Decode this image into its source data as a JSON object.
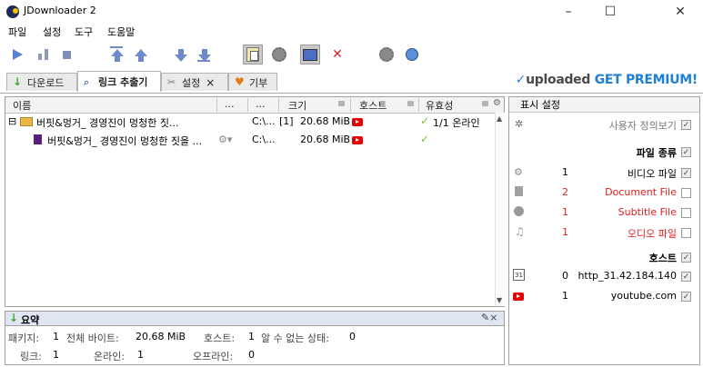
{
  "window": {
    "title": "JDownloader 2",
    "minimize_icon": "minimize-icon",
    "maximize_icon": "maximize-icon",
    "close_icon": "close-icon"
  },
  "menu": [
    "파일",
    "설정",
    "도구",
    "도움말"
  ],
  "tabs": [
    {
      "label": "다운로드",
      "icon": "download-arrow-icon"
    },
    {
      "label": "링크 추출기",
      "icon": "linkgrabber-icon"
    },
    {
      "label": "설정",
      "icon": "settings-icon",
      "close": "×"
    },
    {
      "label": "기부",
      "icon": "heart-icon"
    }
  ],
  "banner": {
    "brand": "uploaded",
    "cta": "GET PREMIUM!"
  },
  "table": {
    "columns": [
      "이름",
      "...",
      "...",
      "크기",
      "호스트",
      "유효성"
    ],
    "rows": [
      {
        "expander": "⊟",
        "name": "버핏&멍거_ 경영진이 멍청한 짓...",
        "path": "C:\\...",
        "count": "[1]",
        "size": "20.68 MiB",
        "host": "youtube",
        "status": "1/1 온라인"
      },
      {
        "name": "버핏&멍거_ 경영진이 멍청한 짓을 ...",
        "path": "C:\\...",
        "size": "20.68 MiB",
        "host": "youtube",
        "status": ""
      }
    ]
  },
  "summary": {
    "title": "요약",
    "packages_label": "패키지:",
    "packages": "1",
    "total_bytes_label": "전체 바이트:",
    "total_bytes": "20.68 MiB",
    "hosts_label": "호스트:",
    "hosts": "1",
    "unknown_label": "알 수 없는 상태:",
    "unknown": "0",
    "links_label": "링크:",
    "links": "1",
    "online_label": "온라인:",
    "online": "1",
    "offline_label": "오프라인:",
    "offline": "0",
    "tools": "✎×"
  },
  "sidebar": {
    "title": "표시 설정",
    "custom_view": "사용자 정의보기",
    "file_types_header": "파일 종류",
    "file_types": [
      {
        "count": "1",
        "label": "비디오 파일",
        "checked": true,
        "red": false
      },
      {
        "count": "2",
        "label": "Document File",
        "checked": false,
        "red": true
      },
      {
        "count": "1",
        "label": "Subtitle File",
        "checked": false,
        "red": true
      },
      {
        "count": "1",
        "label": "오디오 파일",
        "checked": false,
        "red": true
      }
    ],
    "hosts_header": "호스트",
    "hosts": [
      {
        "count": "0",
        "label": "http_31.42.184.140",
        "checked": true,
        "icon": "calendar-31-icon"
      },
      {
        "count": "1",
        "label": "youtube.com",
        "checked": true,
        "icon": "youtube-icon"
      }
    ],
    "check_mark": "✓"
  },
  "colors": {
    "accent": "#2b7fd8",
    "red": "#e02020",
    "youtube": "#e60000",
    "ok": "#7cbf3a"
  }
}
